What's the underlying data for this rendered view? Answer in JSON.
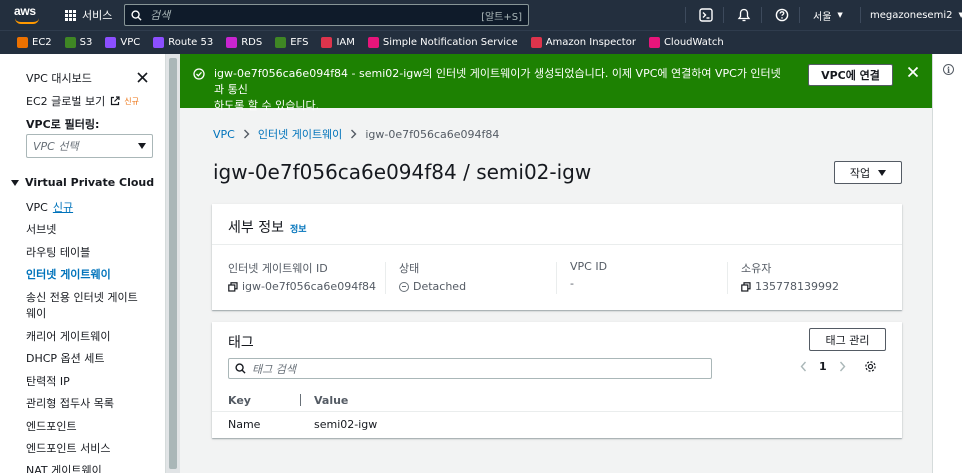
{
  "topnav": {
    "logo_text": "aws",
    "services_label": "서비스",
    "search_placeholder": "검색",
    "search_shortcut": "[알트+S]",
    "region": "서울",
    "account": "megazonesemi2"
  },
  "bookmarks": [
    {
      "label": "EC2",
      "color": "#ed7100"
    },
    {
      "label": "S3",
      "color": "#3f8624"
    },
    {
      "label": "VPC",
      "color": "#8c4fff"
    },
    {
      "label": "Route 53",
      "color": "#8c4fff"
    },
    {
      "label": "RDS",
      "color": "#c925d1"
    },
    {
      "label": "EFS",
      "color": "#3f8624"
    },
    {
      "label": "IAM",
      "color": "#dd344c"
    },
    {
      "label": "Simple Notification Service",
      "color": "#e7157b"
    },
    {
      "label": "Amazon Inspector",
      "color": "#dd344c"
    },
    {
      "label": "CloudWatch",
      "color": "#e7157b"
    }
  ],
  "sidebar": {
    "dashboard": "VPC 대시보드",
    "global_view": "EC2 글로벌 보기",
    "global_view_badge": "신규",
    "filter_label": "VPC로 필터링:",
    "filter_placeholder": "VPC 선택",
    "section": "Virtual Private Cloud",
    "items": [
      {
        "label": "VPC",
        "badge": "신규"
      },
      {
        "label": "서브넷"
      },
      {
        "label": "라우팅 테이블"
      },
      {
        "label": "인터넷 게이트웨이"
      },
      {
        "label": "송신 전용 인터넷 게이트"
      },
      {
        "label": "웨이"
      },
      {
        "label": "캐리어 게이트웨이"
      },
      {
        "label": "DHCP 옵션 세트"
      },
      {
        "label": "탄력적 IP"
      },
      {
        "label": "관리형 접두사 목록"
      },
      {
        "label": "엔드포인트"
      },
      {
        "label": "엔드포인트 서비스"
      },
      {
        "label": "NAT 게이트웨이"
      }
    ]
  },
  "flash": {
    "message_line1": "igw-0e7f056ca6e094f84 - semi02-igw의 인터넷 게이트웨이가 생성되었습니다. 이제 VPC에 연결하여 VPC가 인터넷과 통신",
    "message_line2": "하도록 할 수 있습니다.",
    "action": "VPC에 연결",
    "status_color": "#1d8102"
  },
  "breadcrumb": {
    "items": [
      "VPC",
      "인터넷 게이트웨이",
      "igw-0e7f056ca6e094f84"
    ]
  },
  "page": {
    "title": "igw-0e7f056ca6e094f84 / semi02-igw",
    "actions": "작업"
  },
  "details": {
    "title": "세부 정보",
    "info": "정보",
    "columns": [
      {
        "label": "인터넷 게이트웨이 ID",
        "value": "igw-0e7f056ca6e094f84"
      },
      {
        "label": "상태",
        "value": "Detached"
      },
      {
        "label": "VPC ID",
        "value": "-"
      },
      {
        "label": "소유자",
        "value": "135778139992"
      }
    ]
  },
  "tags": {
    "title": "태그",
    "manage": "태그 관리",
    "search_placeholder": "태그 검색",
    "page": "1",
    "headers": [
      "Key",
      "Value"
    ],
    "rows": [
      {
        "key": "Name",
        "value": "semi02-igw"
      }
    ]
  }
}
